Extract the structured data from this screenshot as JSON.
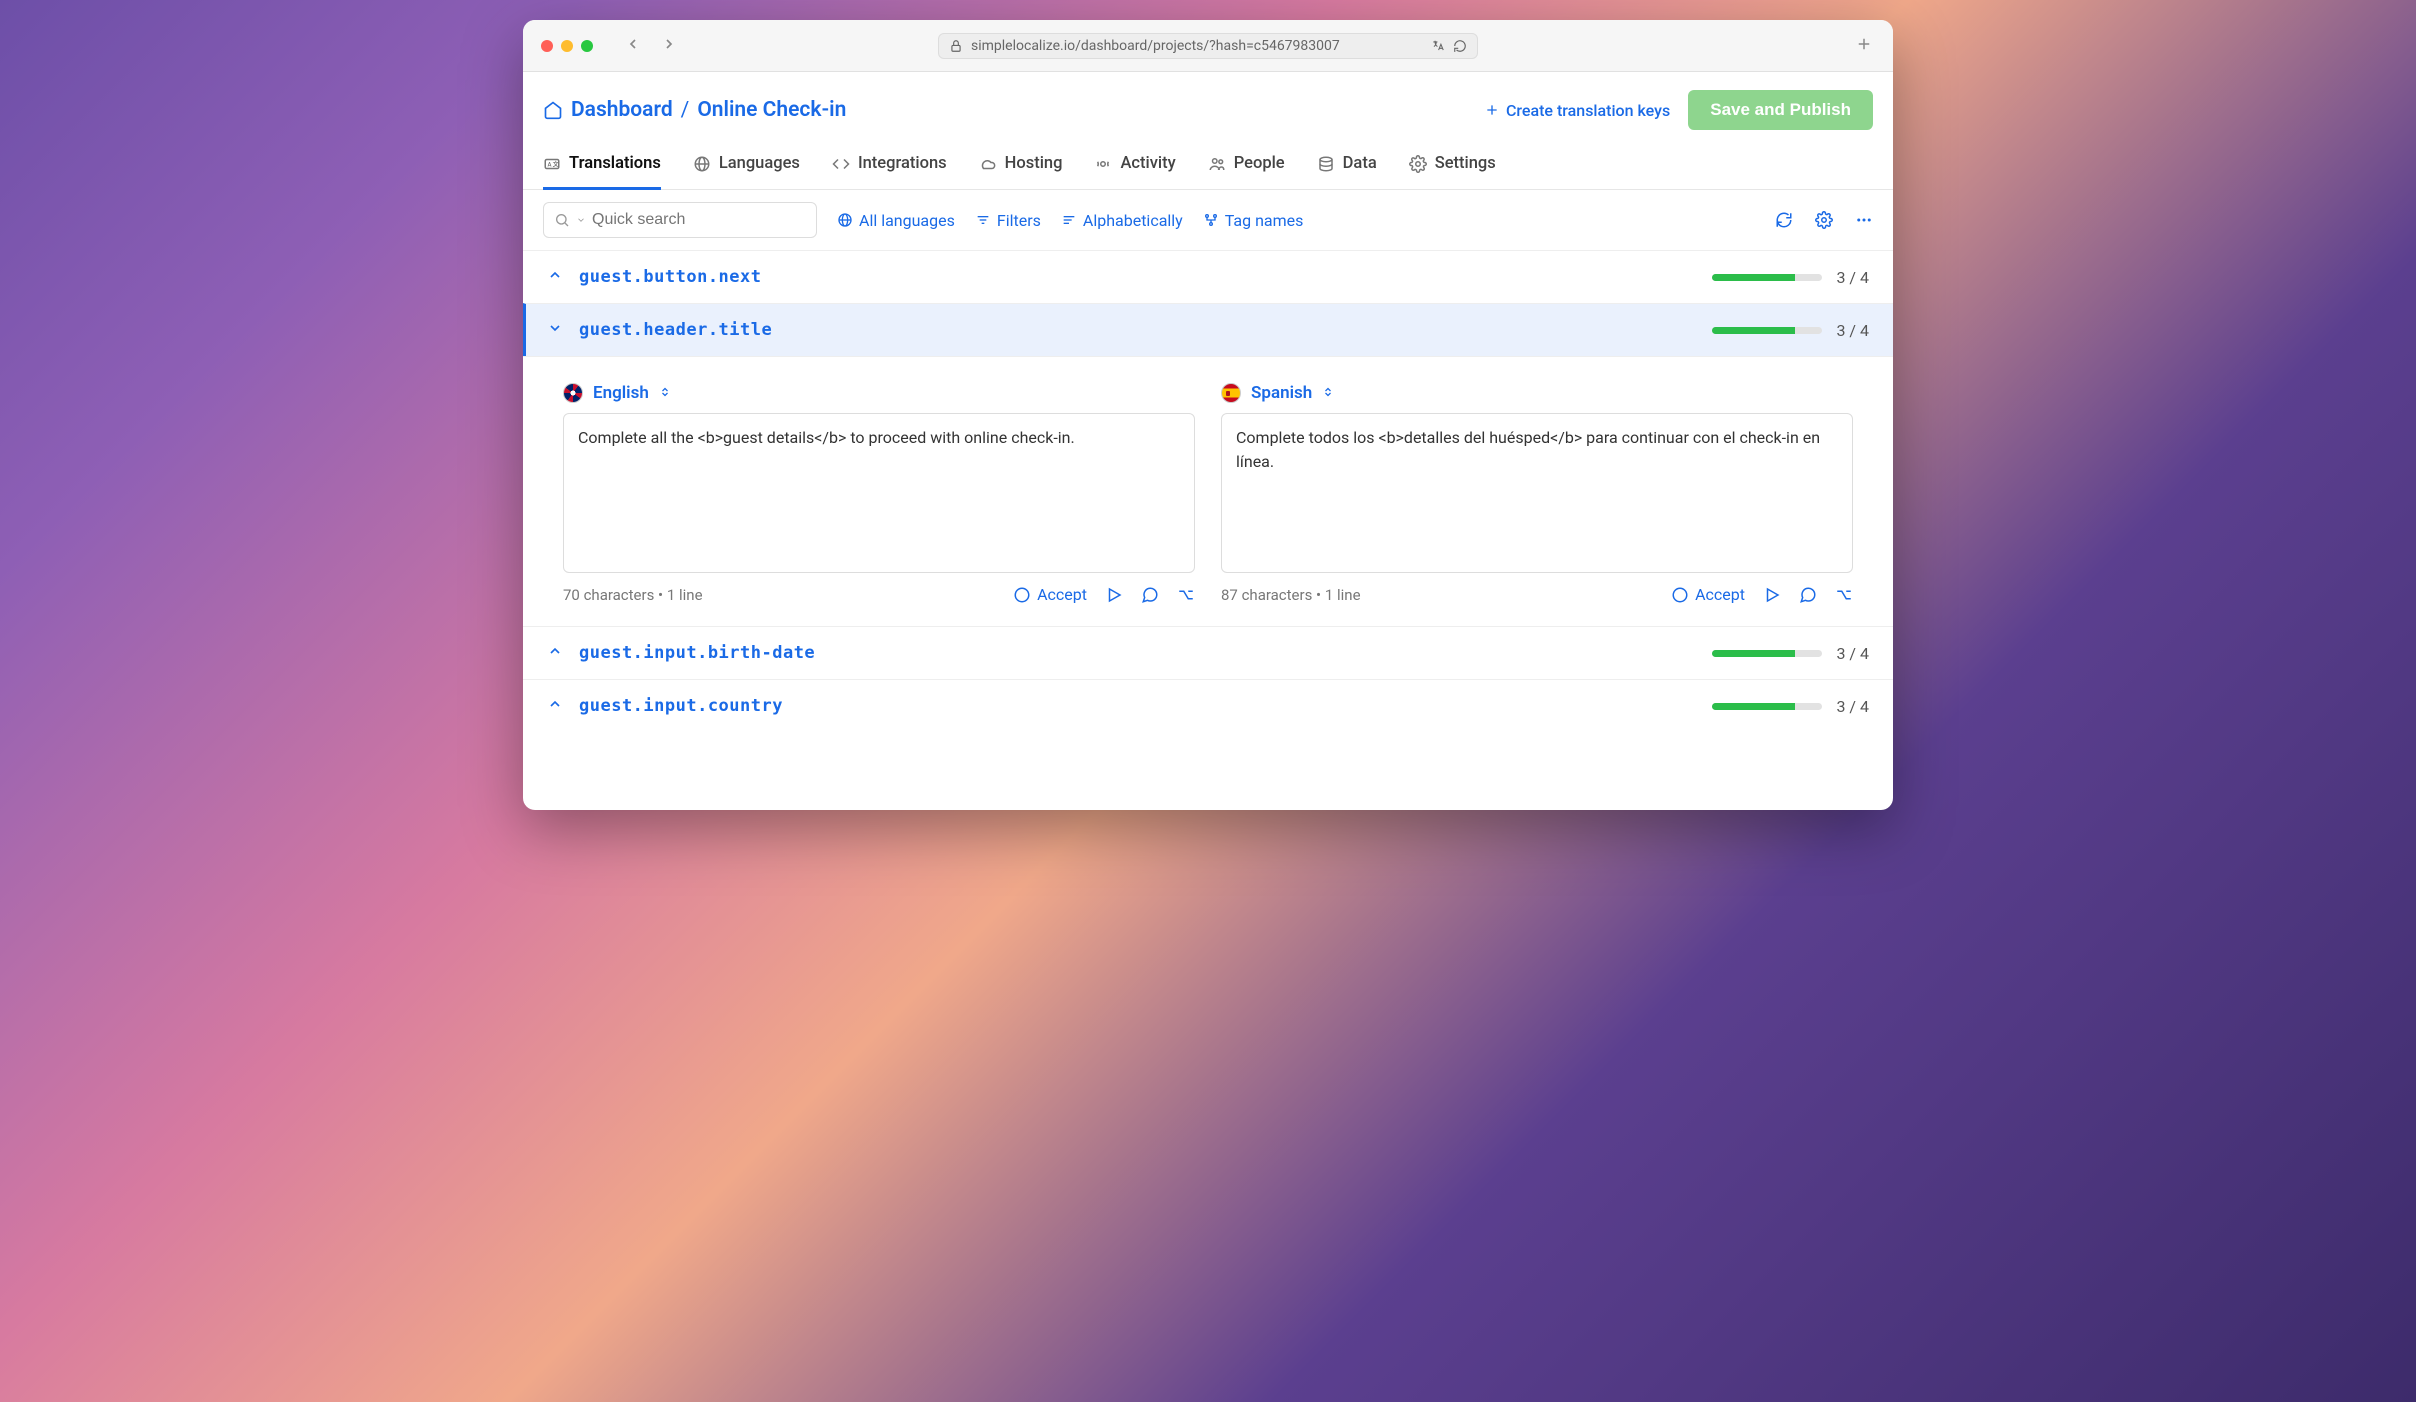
{
  "browser": {
    "url": "simplelocalize.io/dashboard/projects/?hash=c5467983007"
  },
  "breadcrumb": {
    "root": "Dashboard",
    "sep": "/",
    "current": "Online Check-in"
  },
  "header_actions": {
    "create_keys": "Create translation keys",
    "save_publish": "Save and Publish"
  },
  "tabs": {
    "translations": "Translations",
    "languages": "Languages",
    "integrations": "Integrations",
    "hosting": "Hosting",
    "activity": "Activity",
    "people": "People",
    "data": "Data",
    "settings": "Settings"
  },
  "toolbar": {
    "search_placeholder": "Quick search",
    "all_languages": "All languages",
    "filters": "Filters",
    "sort": "Alphabetically",
    "tag_names": "Tag names"
  },
  "keys": [
    {
      "name": "guest.button.next",
      "done": "3 / 4",
      "expanded": false
    },
    {
      "name": "guest.header.title",
      "done": "3 / 4",
      "expanded": true
    },
    {
      "name": "guest.input.birth-date",
      "done": "3 / 4",
      "expanded": false
    },
    {
      "name": "guest.input.country",
      "done": "3 / 4",
      "expanded": false
    }
  ],
  "editor": {
    "left": {
      "language": "English",
      "text": "Complete all the <b>guest details</b> to proceed with online check-in.",
      "stats": "70 characters  •  1 line",
      "accept": "Accept"
    },
    "right": {
      "language": "Spanish",
      "text": "Complete todos los <b>detalles del huésped</b> para continuar con el check-in en línea.",
      "stats": "87 characters  •  1 line",
      "accept": "Accept"
    }
  }
}
